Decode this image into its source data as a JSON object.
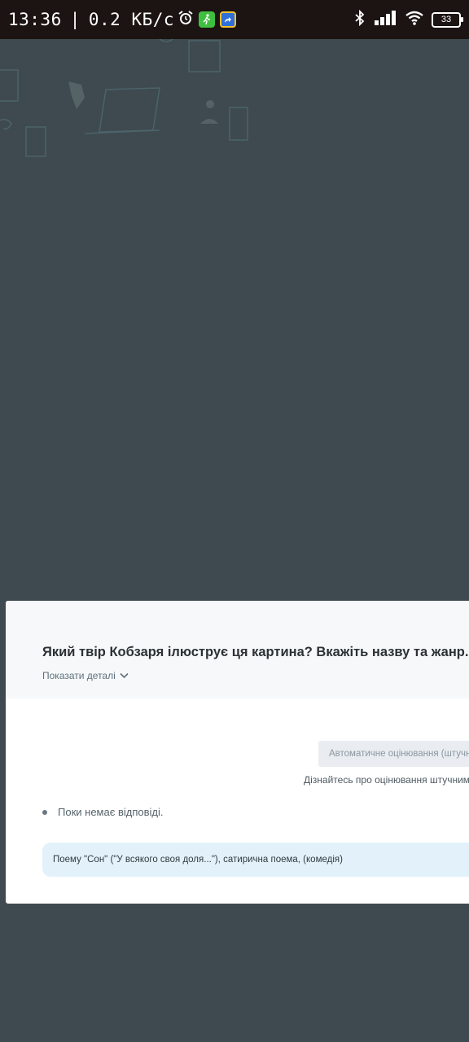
{
  "status_bar": {
    "time": "13:36",
    "separator": "|",
    "network_speed": "0.2 КБ/с",
    "battery_level": "33",
    "icons": [
      "alarm-icon",
      "walk-app-icon",
      "share-app-icon",
      "bluetooth-icon",
      "signal-icon",
      "wifi-icon",
      "battery-icon"
    ]
  },
  "question": {
    "text": "Який твір Кобзаря ілюструє ця картина? Вкажіть назву та жанр.",
    "details_toggle": "Показати деталі"
  },
  "grading": {
    "auto_button_label": "Автоматичне оцінювання (штучн",
    "learn_more": "Дізнайтесь про оцінювання штучним і"
  },
  "answers": {
    "empty_state": "Поки немає відповіді.",
    "suggested_answer": "Поему \"Сон\" (\"У всякого своя доля...\"), сатирична поема, (комедія)"
  },
  "colors": {
    "overlay": "#3e4a50",
    "status_bar": "#1c1412",
    "panel": "#ffffff",
    "panel_header": "#f6f8fa",
    "answer_bg": "#e3f2fa"
  }
}
